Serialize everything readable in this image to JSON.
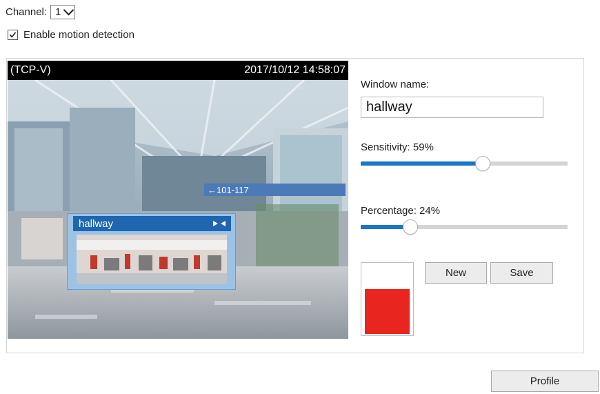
{
  "channel": {
    "label": "Channel:",
    "value": "1"
  },
  "enable_motion": {
    "label": "Enable motion detection",
    "checked": true
  },
  "video": {
    "overlay_left": "(TCP-V)",
    "timestamp": "2017/10/12 14:58:07",
    "scene_sign": "←101-117",
    "motion_window": {
      "name": "hallway",
      "close_icon": "close-x-icon"
    }
  },
  "settings": {
    "window_name_label": "Window name:",
    "window_name_value": "hallway",
    "sensitivity": {
      "label": "Sensitivity: 59%",
      "value": 59
    },
    "percentage": {
      "label": "Percentage: 24%",
      "value": 24
    },
    "swatch_color": "#e8261f"
  },
  "buttons": {
    "new": "New",
    "save": "Save",
    "profile": "Profile"
  },
  "colors": {
    "accent": "#1a76c9",
    "window_header": "#1f66b0"
  }
}
